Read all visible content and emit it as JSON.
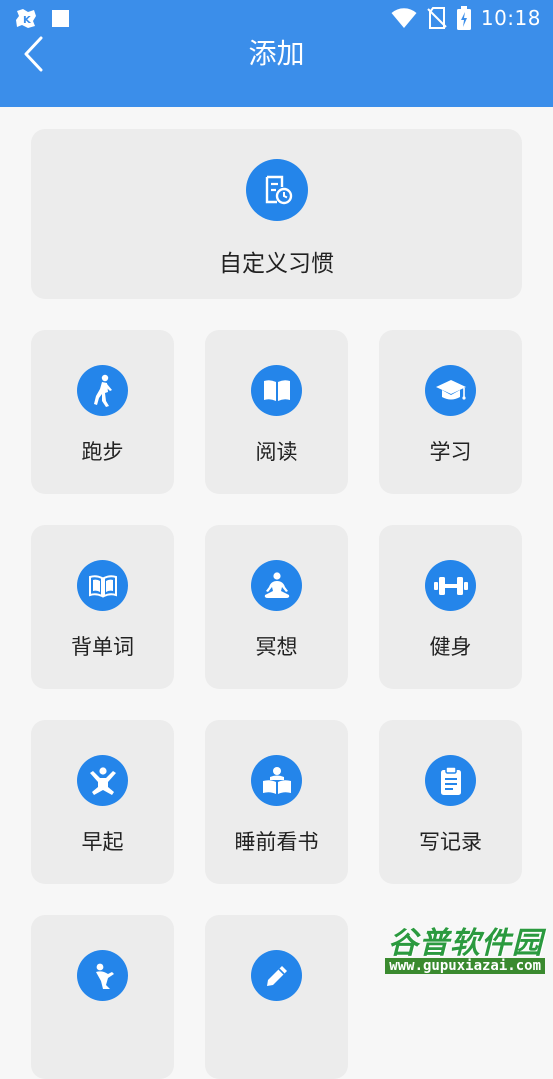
{
  "status_bar": {
    "time": "10:18"
  },
  "nav": {
    "title": "添加"
  },
  "custom_habit": {
    "label": "自定义习惯",
    "icon": "custom-habit-icon"
  },
  "habits": [
    {
      "label": "跑步",
      "icon": "running-icon"
    },
    {
      "label": "阅读",
      "icon": "book-open-icon"
    },
    {
      "label": "学习",
      "icon": "graduation-cap-icon"
    },
    {
      "label": "背单词",
      "icon": "vocabulary-book-icon"
    },
    {
      "label": "冥想",
      "icon": "meditation-icon"
    },
    {
      "label": "健身",
      "icon": "dumbbell-icon"
    },
    {
      "label": "早起",
      "icon": "stretch-person-icon"
    },
    {
      "label": "睡前看书",
      "icon": "reading-person-icon"
    },
    {
      "label": "写记录",
      "icon": "clipboard-icon"
    },
    {
      "label": "",
      "icon": "yoga-pose-icon"
    },
    {
      "label": "",
      "icon": "pencil-icon"
    }
  ],
  "watermark": {
    "brand": "谷普软件园",
    "url": "www.gupuxiazai.com"
  },
  "colors": {
    "primary": "#3b8eea",
    "icon_bg": "#2485ea",
    "card_bg": "#ececec",
    "page_bg": "#f7f7f7"
  }
}
